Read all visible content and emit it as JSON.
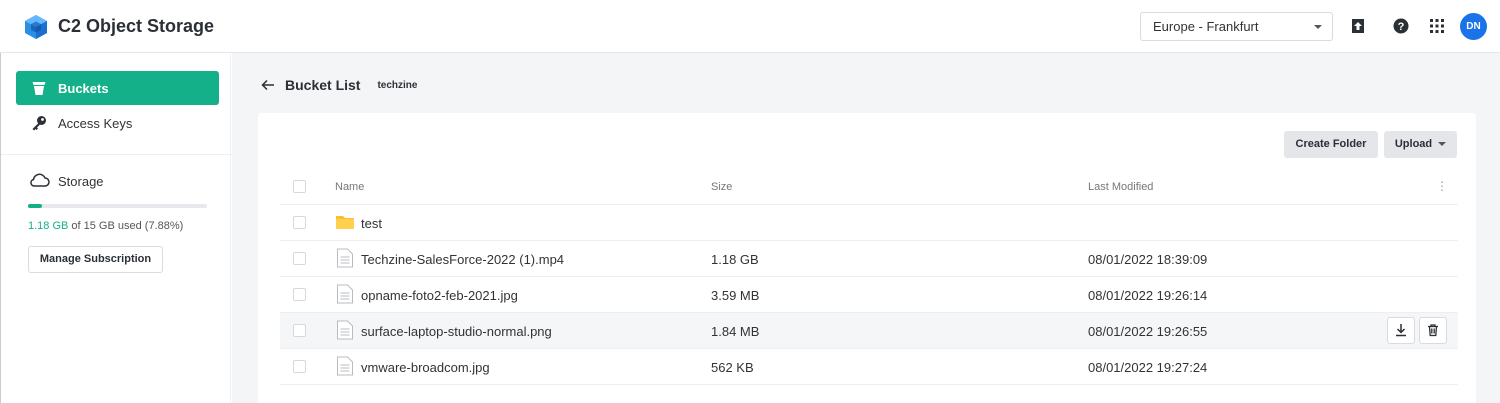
{
  "app": {
    "title": "C2 Object Storage",
    "logo_icon": "cube-logo-icon",
    "brand_color": "#13b089"
  },
  "header": {
    "region_selected": "Europe - Frankfurt",
    "icons": [
      "home-upload-icon",
      "help-icon",
      "apps-grid-icon"
    ],
    "avatar_initials": "DN"
  },
  "sidebar": {
    "items": [
      {
        "label": "Buckets",
        "icon": "bucket-icon",
        "active": true
      },
      {
        "label": "Access Keys",
        "icon": "key-icon",
        "active": false
      }
    ],
    "storage": {
      "label": "Storage",
      "icon": "cloud-icon",
      "used": "1.18 GB",
      "usage_rest": " of 15 GB used (7.88%)",
      "used_fraction": 0.0788,
      "manage_label": "Manage Subscription"
    }
  },
  "main": {
    "breadcrumb": {
      "title": "Bucket List",
      "bucket": "techzine"
    },
    "toolbar": {
      "create_folder": "Create Folder",
      "upload": "Upload"
    },
    "table": {
      "columns": [
        "Name",
        "Size",
        "Last Modified"
      ],
      "rows": [
        {
          "type": "folder",
          "name": "test",
          "size": "",
          "modified": ""
        },
        {
          "type": "file",
          "name": "Techzine-SalesForce-2022 (1).mp4",
          "size": "1.18 GB",
          "modified": "08/01/2022 18:39:09"
        },
        {
          "type": "file",
          "name": "opname-foto2-feb-2021.jpg",
          "size": "3.59 MB",
          "modified": "08/01/2022 19:26:14"
        },
        {
          "type": "file",
          "name": "surface-laptop-studio-normal.png",
          "size": "1.84 MB",
          "modified": "08/01/2022 19:26:55"
        },
        {
          "type": "file",
          "name": "vmware-broadcom.jpg",
          "size": "562 KB",
          "modified": "08/01/2022 19:27:24"
        }
      ]
    }
  }
}
